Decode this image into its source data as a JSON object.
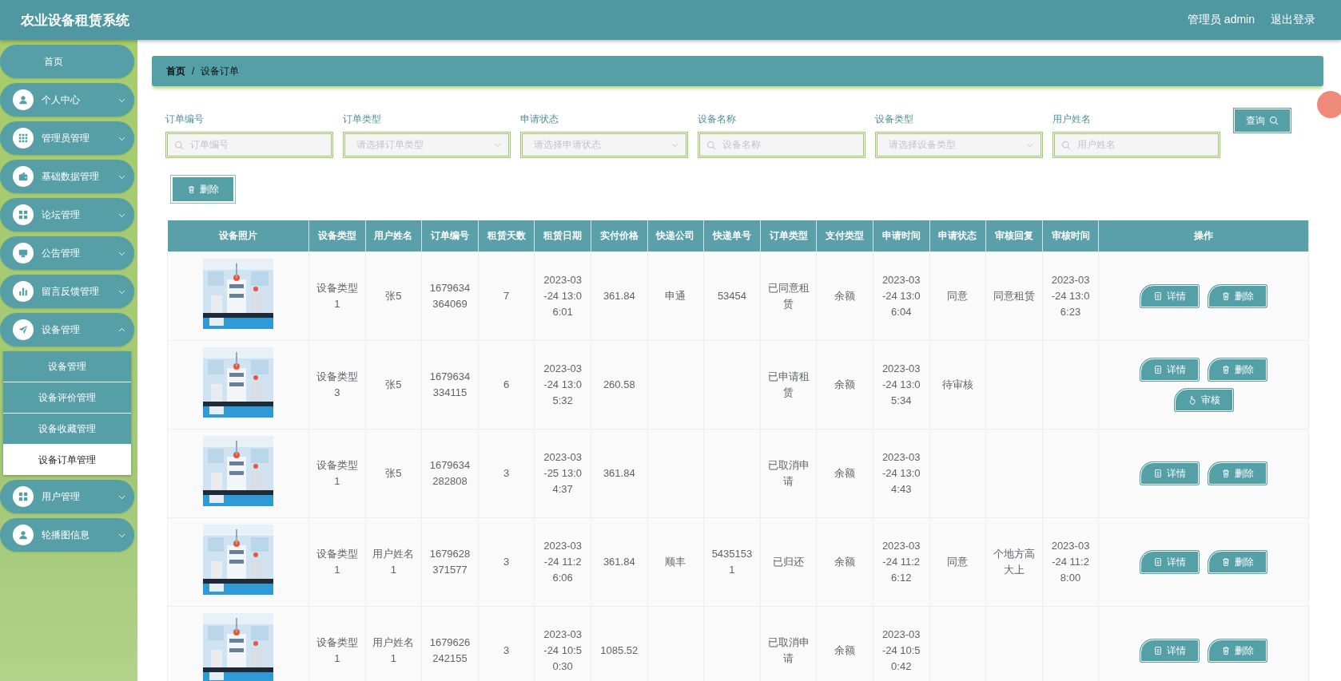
{
  "header": {
    "title": "农业设备租赁系统",
    "user": "管理员 admin",
    "logout": "退出登录"
  },
  "sidebar": {
    "items": [
      {
        "label": "首页",
        "kind": "plain"
      },
      {
        "label": "个人中心",
        "kind": "group",
        "expanded": false
      },
      {
        "label": "管理员管理",
        "kind": "group",
        "expanded": false
      },
      {
        "label": "基础数据管理",
        "kind": "group",
        "expanded": false
      },
      {
        "label": "论坛管理",
        "kind": "group",
        "expanded": false
      },
      {
        "label": "公告管理",
        "kind": "group",
        "expanded": false
      },
      {
        "label": "留言反馈管理",
        "kind": "group",
        "expanded": false
      },
      {
        "label": "设备管理",
        "kind": "group",
        "expanded": true,
        "children": [
          {
            "label": "设备管理",
            "selected": false
          },
          {
            "label": "设备评价管理",
            "selected": false
          },
          {
            "label": "设备收藏管理",
            "selected": false
          },
          {
            "label": "设备订单管理",
            "selected": true
          }
        ]
      },
      {
        "label": "用户管理",
        "kind": "group",
        "expanded": false
      },
      {
        "label": "轮播图信息",
        "kind": "group",
        "expanded": false
      }
    ]
  },
  "breadcrumb": {
    "items": [
      "首页",
      "设备订单"
    ],
    "separator": "/"
  },
  "filters": [
    {
      "label": "订单编号",
      "kind": "text",
      "placeholder": "订单编号"
    },
    {
      "label": "订单类型",
      "kind": "select",
      "placeholder": "请选择订单类型"
    },
    {
      "label": "申请状态",
      "kind": "select",
      "placeholder": "请选择申请状态"
    },
    {
      "label": "设备名称",
      "kind": "text",
      "placeholder": "设备名称"
    },
    {
      "label": "设备类型",
      "kind": "select",
      "placeholder": "请选择设备类型"
    },
    {
      "label": "用户姓名",
      "kind": "text",
      "placeholder": "用户姓名"
    }
  ],
  "search_button": "查询",
  "delete_button": "删除",
  "table": {
    "columns": [
      "设备照片",
      "设备类型",
      "用户姓名",
      "订单编号",
      "租赁天数",
      "租赁日期",
      "实付价格",
      "快递公司",
      "快递单号",
      "订单类型",
      "支付类型",
      "申请时间",
      "申请状态",
      "审核回复",
      "审核时间",
      "操作"
    ],
    "rows": [
      {
        "cells": [
          {
            "kind": "picture"
          },
          "设备类型1",
          "张5",
          "1679634364069",
          "7",
          "2023-03-24 13:06:01",
          "361.84",
          "申通",
          "53454",
          "已同意租赁",
          "余额",
          "2023-03-24 13:06:04",
          "同意",
          "同意租赁",
          "2023-03-24 13:06:23"
        ],
        "actions": [
          {
            "kind": "detail",
            "label": "详情"
          },
          {
            "kind": "delete",
            "label": "删除"
          }
        ]
      },
      {
        "cells": [
          {
            "kind": "picture"
          },
          "设备类型3",
          "张5",
          "1679634334115",
          "6",
          "2023-03-24 13:05:32",
          "260.58",
          "",
          "",
          "已申请租赁",
          "余额",
          "2023-03-24 13:05:34",
          "待审核",
          "",
          ""
        ],
        "actions": [
          {
            "kind": "detail",
            "label": "详情"
          },
          {
            "kind": "delete",
            "label": "删除"
          },
          {
            "kind": "audit",
            "label": "审核"
          }
        ]
      },
      {
        "cells": [
          {
            "kind": "picture"
          },
          "设备类型1",
          "张5",
          "1679634282808",
          "3",
          "2023-03-25 13:04:37",
          "361.84",
          "",
          "",
          "已取消申请",
          "余额",
          "2023-03-24 13:04:43",
          "",
          "",
          ""
        ],
        "actions": [
          {
            "kind": "detail",
            "label": "详情"
          },
          {
            "kind": "delete",
            "label": "删除"
          }
        ]
      },
      {
        "cells": [
          {
            "kind": "picture"
          },
          "设备类型1",
          "用户姓名1",
          "1679628371577",
          "3",
          "2023-03-24 11:26:06",
          "361.84",
          "顺丰",
          "54351531",
          "已归还",
          "余额",
          "2023-03-24 11:26:12",
          "同意",
          "个地方高大上",
          "2023-03-24 11:28:00"
        ],
        "actions": [
          {
            "kind": "detail",
            "label": "详情"
          },
          {
            "kind": "delete",
            "label": "删除"
          }
        ]
      },
      {
        "cells": [
          {
            "kind": "picture"
          },
          "设备类型1",
          "用户姓名1",
          "1679626242155",
          "3",
          "2023-03-24 10:50:30",
          "1085.52",
          "",
          "",
          "已取消申请",
          "余额",
          "2023-03-24 10:50:42",
          "",
          "",
          ""
        ],
        "actions": [
          {
            "kind": "detail",
            "label": "详情"
          },
          {
            "kind": "delete",
            "label": "删除"
          }
        ]
      }
    ]
  }
}
